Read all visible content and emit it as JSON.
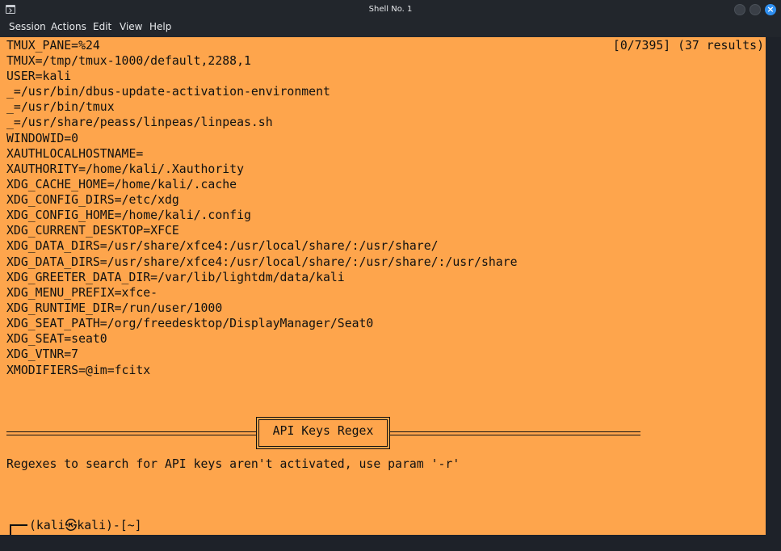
{
  "window": {
    "title": "Shell No. 1",
    "close_glyph": "×"
  },
  "menu": {
    "items": [
      "Session",
      "Actions",
      "Edit",
      "View",
      "Help"
    ]
  },
  "terminal": {
    "background": "#fea54c",
    "search_counter": "[0/7395] (37 results)",
    "lines": [
      "TMUX_PANE=%24",
      "TMUX=/tmp/tmux-1000/default,2288,1",
      "USER=kali",
      "_=/usr/bin/dbus-update-activation-environment",
      "_=/usr/bin/tmux",
      "_=/usr/share/peass/linpeas/linpeas.sh",
      "WINDOWID=0",
      "XAUTHLOCALHOSTNAME=",
      "XAUTHORITY=/home/kali/.Xauthority",
      "XDG_CACHE_HOME=/home/kali/.cache",
      "XDG_CONFIG_DIRS=/etc/xdg",
      "XDG_CONFIG_HOME=/home/kali/.config",
      "XDG_CURRENT_DESKTOP=XFCE",
      "XDG_DATA_DIRS=/usr/share/xfce4:/usr/local/share/:/usr/share/",
      "XDG_DATA_DIRS=/usr/share/xfce4:/usr/local/share/:/usr/share/:/usr/share",
      "XDG_GREETER_DATA_DIR=/var/lib/lightdm/data/kali",
      "XDG_MENU_PREFIX=xfce-",
      "XDG_RUNTIME_DIR=/run/user/1000",
      "XDG_SEAT_PATH=/org/freedesktop/DisplayManager/Seat0",
      "XDG_SEAT=seat0",
      "XDG_VTNR=7",
      "XMODIFIERS=@im=fcitx"
    ],
    "section_title": "API Keys Regex",
    "section_message": "Regexes to search for API keys aren't activated, use param '-r'",
    "prompt_line": "(kali㉿kali)-[~]",
    "prompt_symbol": "$"
  }
}
